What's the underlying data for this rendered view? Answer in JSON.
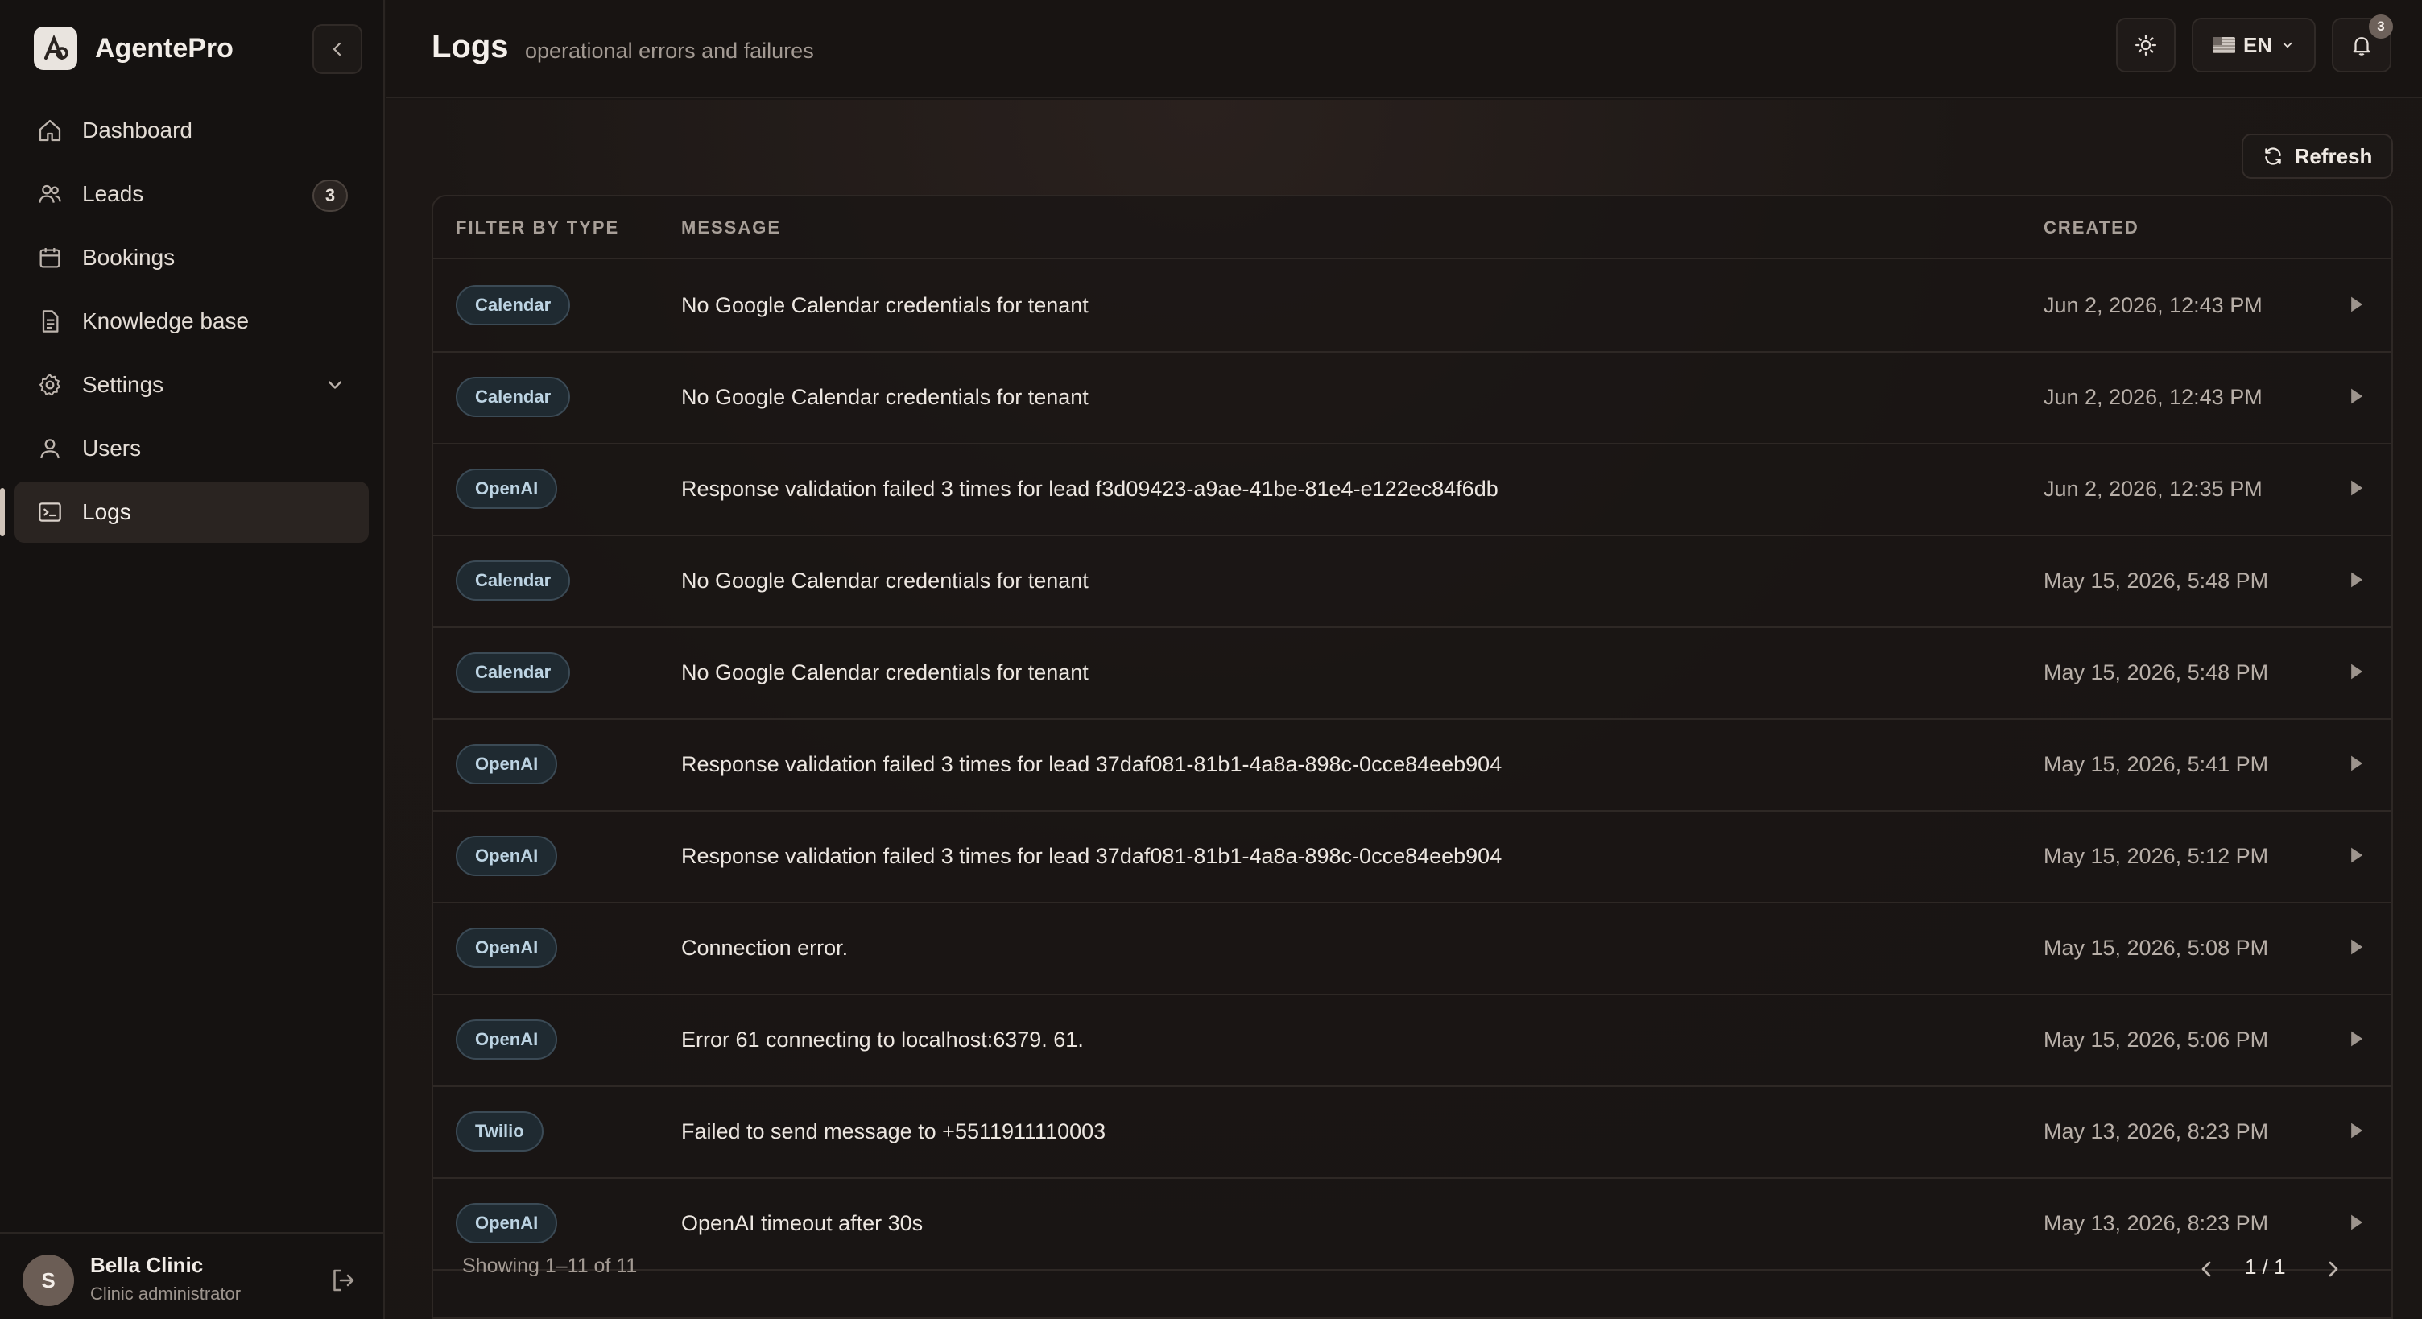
{
  "app": {
    "name": "AgentePro"
  },
  "sidebar": {
    "items": [
      {
        "label": "Dashboard",
        "icon": "home-icon"
      },
      {
        "label": "Leads",
        "icon": "users-icon",
        "badge": "3"
      },
      {
        "label": "Bookings",
        "icon": "calendar-icon"
      },
      {
        "label": "Knowledge base",
        "icon": "document-icon"
      },
      {
        "label": "Settings",
        "icon": "gear-icon"
      },
      {
        "label": "Users",
        "icon": "user-icon"
      },
      {
        "label": "Logs",
        "icon": "terminal-icon",
        "active": true
      }
    ],
    "user": {
      "initial": "S",
      "name": "Bella Clinic",
      "role": "Clinic administrator"
    }
  },
  "header": {
    "title": "Logs",
    "subtitle": "operational errors and failures",
    "language": "EN",
    "notifications_count": "3"
  },
  "toolbar": {
    "refresh_label": "Refresh"
  },
  "table": {
    "columns": {
      "type": "FILTER BY TYPE",
      "message": "MESSAGE",
      "created": "CREATED"
    },
    "rows": [
      {
        "type": "Calendar",
        "message": "No Google Calendar credentials for tenant",
        "created": "Jun 2, 2026, 12:43 PM"
      },
      {
        "type": "Calendar",
        "message": "No Google Calendar credentials for tenant",
        "created": "Jun 2, 2026, 12:43 PM"
      },
      {
        "type": "OpenAI",
        "message": "Response validation failed 3 times for lead f3d09423-a9ae-41be-81e4-e122ec84f6db",
        "created": "Jun 2, 2026, 12:35 PM"
      },
      {
        "type": "Calendar",
        "message": "No Google Calendar credentials for tenant",
        "created": "May 15, 2026, 5:48 PM"
      },
      {
        "type": "Calendar",
        "message": "No Google Calendar credentials for tenant",
        "created": "May 15, 2026, 5:48 PM"
      },
      {
        "type": "OpenAI",
        "message": "Response validation failed 3 times for lead 37daf081-81b1-4a8a-898c-0cce84eeb904",
        "created": "May 15, 2026, 5:41 PM"
      },
      {
        "type": "OpenAI",
        "message": "Response validation failed 3 times for lead 37daf081-81b1-4a8a-898c-0cce84eeb904",
        "created": "May 15, 2026, 5:12 PM"
      },
      {
        "type": "OpenAI",
        "message": "Connection error.",
        "created": "May 15, 2026, 5:08 PM"
      },
      {
        "type": "OpenAI",
        "message": "Error 61 connecting to localhost:6379. 61.",
        "created": "May 15, 2026, 5:06 PM"
      },
      {
        "type": "Twilio",
        "message": "Failed to send message to +5511911110003",
        "created": "May 13, 2026, 8:23 PM"
      },
      {
        "type": "OpenAI",
        "message": "OpenAI timeout after 30s",
        "created": "May 13, 2026, 8:23 PM"
      }
    ]
  },
  "pagination": {
    "showing": "Showing 1–11 of 11",
    "page": "1 / 1"
  },
  "colors": {
    "background": "#1a1614",
    "sidebar": "#151211",
    "badge_bg": "#1f2a31",
    "badge_text": "#bcd3e2"
  }
}
